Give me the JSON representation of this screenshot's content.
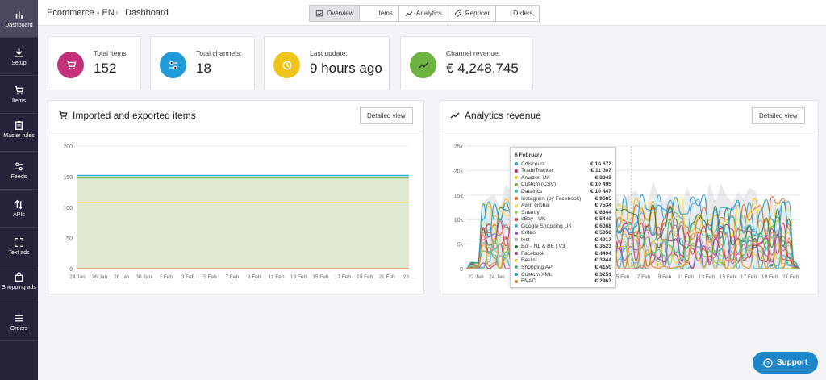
{
  "sidebar": {
    "items": [
      {
        "label": "Dashboard",
        "icon": "bar-chart-icon",
        "active": true
      },
      {
        "label": "Setup",
        "icon": "download-icon"
      },
      {
        "label": "Items",
        "icon": "cart-icon"
      },
      {
        "label": "Master rules",
        "icon": "clipboard-icon"
      },
      {
        "label": "Feeds",
        "icon": "sliders-icon"
      },
      {
        "label": "APIs",
        "icon": "swap-icon"
      },
      {
        "label": "Text ads",
        "icon": "fullscreen-icon"
      },
      {
        "label": "Shopping ads",
        "icon": "bag-icon"
      },
      {
        "label": "Orders",
        "icon": "list-icon"
      }
    ]
  },
  "header": {
    "breadcrumb_root": "Ecommerce - EN",
    "breadcrumb_sep": "›",
    "breadcrumb_current": "Dashboard"
  },
  "tabs": [
    {
      "label": "Overview",
      "icon": "chart-image-icon",
      "active": true
    },
    {
      "label": "Items",
      "icon": "cart-icon"
    },
    {
      "label": "Analytics",
      "icon": "trend-icon"
    },
    {
      "label": "Repricer",
      "icon": "tag-icon"
    },
    {
      "label": "Orders",
      "icon": "list-icon"
    }
  ],
  "stats": [
    {
      "label": "Total items:",
      "value": "152",
      "color": "#c4307a",
      "icon": "cart-icon"
    },
    {
      "label": "Total channels:",
      "value": "18",
      "color": "#1f9bd8",
      "icon": "sliders-icon"
    },
    {
      "label": "Last update:",
      "value": "9 hours ago",
      "color": "#f0c419",
      "icon": "clock-icon"
    },
    {
      "label": "Channel revenue:",
      "value": "€ 4,248,745",
      "color": "#6db33f",
      "icon": "trend-icon"
    }
  ],
  "items_panel": {
    "title": "Imported and exported items",
    "button": "Detailed view"
  },
  "revenue_panel": {
    "title": "Analytics revenue",
    "button": "Detailed view"
  },
  "chart_data": [
    {
      "type": "line",
      "title": "Imported and exported items",
      "x": [
        "24 Jan",
        "26 Jan",
        "28 Jan",
        "30 Jan",
        "1 Feb",
        "3 Feb",
        "5 Feb",
        "7 Feb",
        "9 Feb",
        "11 Feb",
        "13 Feb",
        "15 Feb",
        "17 Feb",
        "19 Feb",
        "21 Feb",
        "23 ..."
      ],
      "yticks": [
        "0",
        "50",
        "100",
        "150",
        "200"
      ],
      "ylim": [
        0,
        200
      ],
      "series": [
        {
          "values": [
            152,
            152,
            152,
            152,
            152,
            152,
            152,
            152,
            152,
            152,
            152,
            152,
            152,
            152,
            152,
            152
          ],
          "color": "#2ea9d6"
        },
        {
          "values": [
            148,
            148,
            148,
            148,
            148,
            148,
            148,
            148,
            148,
            148,
            148,
            148,
            148,
            148,
            148,
            148
          ],
          "color": "#8bbf5a",
          "fill": true
        },
        {
          "values": [
            108,
            108,
            108,
            108,
            108,
            108,
            108,
            108,
            108,
            108,
            108,
            108,
            108,
            108,
            108,
            108
          ],
          "color": "#f0e06a"
        },
        {
          "values": [
            0,
            0,
            0,
            0,
            0,
            0,
            0,
            0,
            0,
            0,
            0,
            0,
            0,
            0,
            0,
            0
          ],
          "color": "#e8632c"
        }
      ]
    },
    {
      "type": "area",
      "title": "Analytics revenue",
      "x": [
        "22 Jan",
        "24 Jan",
        "26 Jan",
        "28 Jan",
        "30 Jan",
        "1 Feb",
        "3 Feb",
        "5 Feb",
        "7 Feb",
        "9 Feb",
        "11 Feb",
        "13 Feb",
        "15 Feb",
        "17 Feb",
        "19 Feb",
        "21 Feb"
      ],
      "yticks": [
        "0",
        "5k",
        "10k",
        "15k",
        "20k",
        "25k"
      ],
      "ylim": [
        0,
        25000
      ],
      "tooltip": {
        "date": "6 February",
        "rows": [
          {
            "name": "Cdiscount",
            "value": "€ 10 672",
            "color": "#2ea9d6"
          },
          {
            "name": "TradeTracker",
            "value": "€ 11 007",
            "color": "#c4307a"
          },
          {
            "name": "Amazon UK",
            "value": "€ 8349",
            "color": "#f0c419"
          },
          {
            "name": "Custom (CSV)",
            "value": "€ 10 495",
            "color": "#6db33f"
          },
          {
            "name": "Datatrics",
            "value": "€ 10 447",
            "color": "#3cc3c8"
          },
          {
            "name": "Instagram (by Facebook)",
            "value": "€ 9685",
            "color": "#e8632c"
          },
          {
            "name": "Awin Global",
            "value": "€ 7534",
            "color": "#f4e04d"
          },
          {
            "name": "Smartly",
            "value": "€ 6344",
            "color": "#9bd46a"
          },
          {
            "name": "eBay - UK",
            "value": "€ 5440",
            "color": "#d9344a"
          },
          {
            "name": "Google Shopping UK",
            "value": "€ 6068",
            "color": "#4fb3e8"
          },
          {
            "name": "Criteo",
            "value": "€ 5358",
            "color": "#8a5cc7"
          },
          {
            "name": "test",
            "value": "€ 4917",
            "color": "#b0b0b0"
          },
          {
            "name": "Bol - NL & BE | V3",
            "value": "€ 3523",
            "color": "#2c7a3f"
          },
          {
            "name": "Facebook",
            "value": "€ 4494",
            "color": "#c0367e"
          },
          {
            "name": "Beslist",
            "value": "€ 3944",
            "color": "#e9c53a"
          },
          {
            "name": "Shopping API",
            "value": "€ 4150",
            "color": "#3cbf7a"
          },
          {
            "name": "Custom XML",
            "value": "€ 3251",
            "color": "#1f9bd8"
          },
          {
            "name": "FNAC",
            "value": "€ 2967",
            "color": "#f08a2c"
          }
        ]
      }
    }
  ],
  "support": {
    "label": "Support"
  }
}
